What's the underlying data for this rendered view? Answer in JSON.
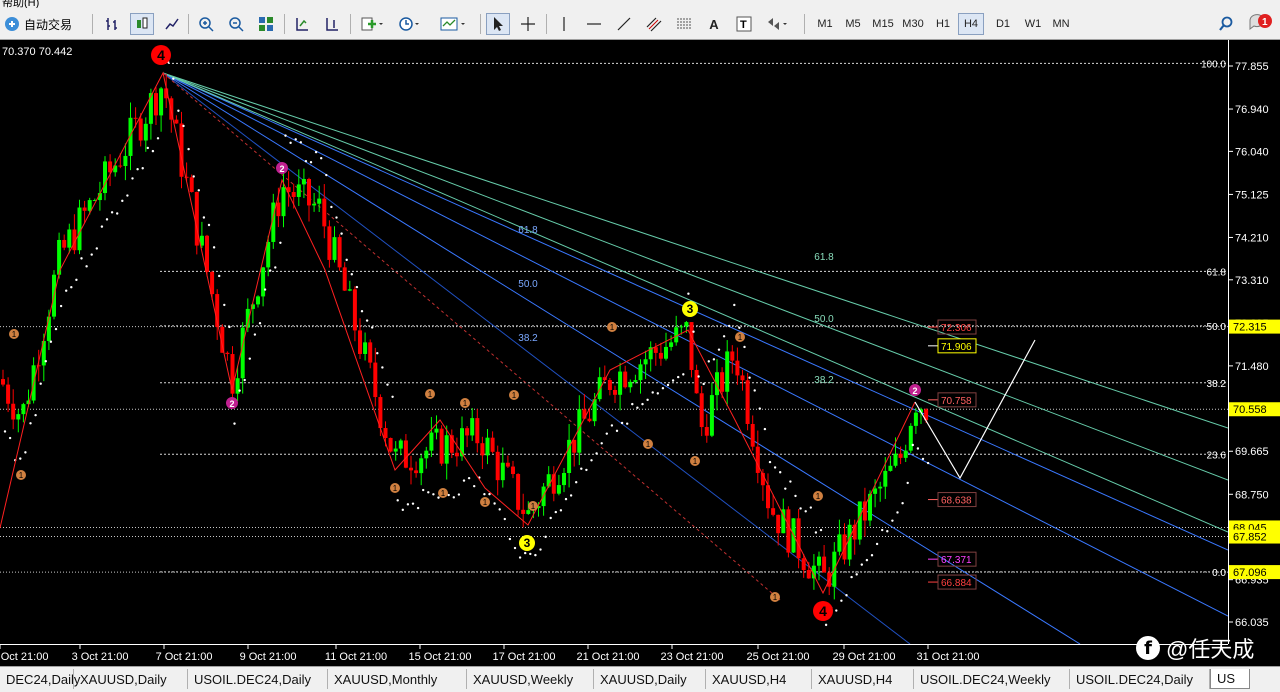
{
  "menubar": {
    "text": "帮助(H)"
  },
  "toolbar": {
    "autotrade_label": "自动交易",
    "timeframes": [
      "M1",
      "M5",
      "M15",
      "M30",
      "H1",
      "H4",
      "D1",
      "W1",
      "MN"
    ],
    "active_timeframe": "H4",
    "notification_count": "1"
  },
  "chart": {
    "ohlc_text": "70.370 70.442",
    "price_ticks": [
      "77.855",
      "76.940",
      "76.040",
      "75.125",
      "74.210",
      "73.310",
      "72.395",
      "71.480",
      "70.565",
      "69.665",
      "68.750",
      "67.835",
      "66.935",
      "66.035"
    ],
    "time_ticks": [
      "0 Oct 21:00",
      "3 Oct 21:00",
      "7 Oct 21:00",
      "9 Oct 21:00",
      "11 Oct 21:00",
      "15 Oct 21:00",
      "17 Oct 21:00",
      "21 Oct 21:00",
      "23 Oct 21:00",
      "25 Oct 21:00",
      "29 Oct 21:00",
      "31 Oct 21:00"
    ],
    "fib_levels": [
      {
        "label": "100.0",
        "price": 77.91
      },
      {
        "label": "61.8",
        "price": 73.49
      },
      {
        "label": "50.0",
        "price": 72.33
      },
      {
        "label": "38.2",
        "price": 71.12
      },
      {
        "label": "23.6",
        "price": 69.6
      },
      {
        "label": "0.0",
        "price": 67.1
      }
    ],
    "fan_labels": [
      {
        "label": "61.8",
        "group": "blue"
      },
      {
        "label": "50.0",
        "group": "blue"
      },
      {
        "label": "38.2",
        "group": "blue"
      },
      {
        "label": "61.8",
        "group": "green"
      },
      {
        "label": "50.0",
        "group": "green"
      },
      {
        "label": "38.2",
        "group": "green"
      }
    ],
    "price_badges": [
      {
        "text": "72.315",
        "price": 72.315,
        "bg": "#ffff00",
        "fg": "#000000"
      },
      {
        "text": "70.558",
        "price": 70.558,
        "bg": "#ffff00",
        "fg": "#000000"
      },
      {
        "text": "68.045",
        "price": 68.045,
        "bg": "#ffff00",
        "fg": "#000000"
      },
      {
        "text": "67.852",
        "price": 67.852,
        "bg": "#ffff00",
        "fg": "#000000"
      },
      {
        "text": "67.096",
        "price": 67.096,
        "bg": "#ffff00",
        "fg": "#000000"
      }
    ],
    "chart_labels": [
      {
        "text": "72.306",
        "price": 72.306,
        "color": "#ff4040"
      },
      {
        "text": "71.906",
        "price": 71.906,
        "color": "#ffff00"
      },
      {
        "text": "70.758",
        "price": 70.758,
        "color": "#ff6060"
      },
      {
        "text": "68.638",
        "price": 68.638,
        "color": "#ff6060"
      },
      {
        "text": "67.371",
        "price": 67.371,
        "color": "#ff40ff"
      },
      {
        "text": "66.884",
        "price": 66.884,
        "color": "#ff4040"
      }
    ],
    "wave_markers": [
      {
        "text": "4",
        "style": "red-big"
      },
      {
        "text": "3",
        "style": "yellow"
      },
      {
        "text": "3",
        "style": "yellow"
      },
      {
        "text": "4",
        "style": "red-big"
      },
      {
        "text": "2",
        "style": "magenta"
      },
      {
        "text": "2",
        "style": "magenta"
      },
      {
        "text": "2",
        "style": "magenta"
      }
    ]
  },
  "tabs": [
    "DEC24,Daily",
    "XAUUSD,Daily",
    "USOIL.DEC24,Daily",
    "XAUUSD,Monthly",
    "XAUUSD,Weekly",
    "XAUUSD,Daily",
    "XAUUSD,H4",
    "XAUUSD,H4",
    "USOIL.DEC24,Weekly",
    "USOIL.DEC24,Daily",
    "US"
  ],
  "active_tab_index": 10,
  "watermark": {
    "text": "@任天成",
    "logo": "f"
  },
  "colors": {
    "bull": "#00ff00",
    "bear": "#ff0000",
    "fib": "#ffffff",
    "fan_blue": "#3a78ff",
    "fan_green": "#66ccaa"
  }
}
